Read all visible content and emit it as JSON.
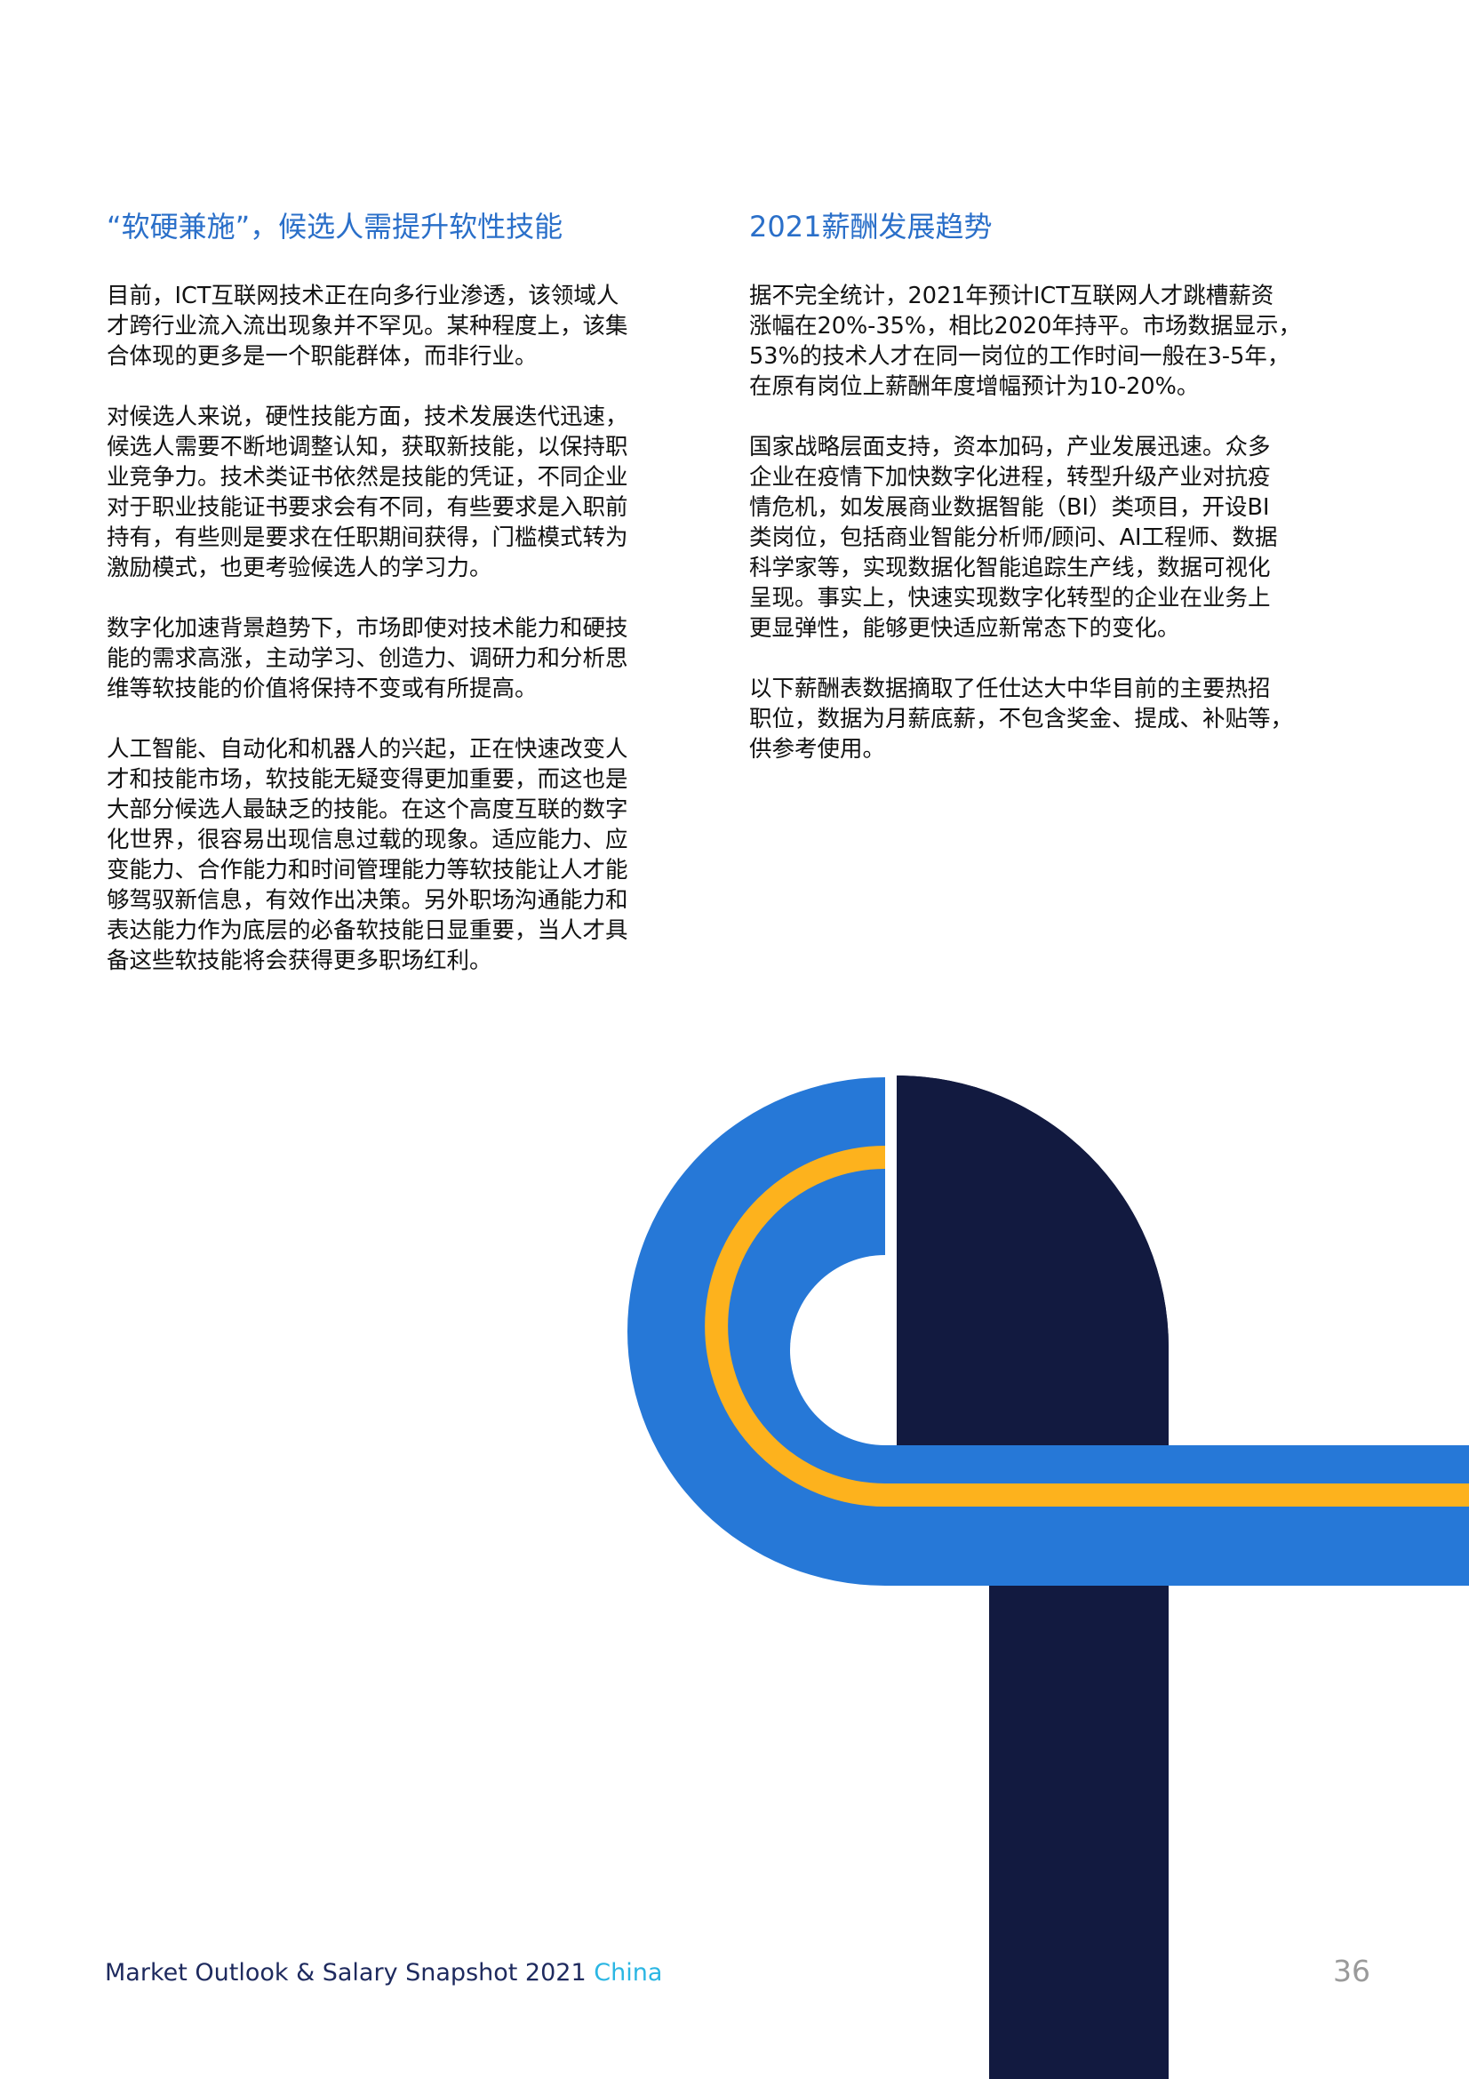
{
  "colors": {
    "heading": "#2a6fc9",
    "navy": "#121a40",
    "blue": "#2678d7",
    "yellow": "#fdb21d",
    "footer_text": "#1e2a5e",
    "footer_accent": "#2bb6e3",
    "page_num": "#9a9a9a"
  },
  "left_column": {
    "heading": "“软硬兼施”，候选人需提升软性技能",
    "paragraphs": [
      {
        "lines": [
          "目前，ICT互联网技术正在向多行业渗透，该领域人",
          "才跨行业流入流出现象并不罕见。某种程度上，该集",
          "合体现的更多是一个职能群体，而非行业。"
        ]
      },
      {
        "lines": [
          "对候选人来说，硬性技能方面，技术发展迭代迅速，",
          "候选人需要不断地调整认知，获取新技能，以保持职",
          "业竞争力。技术类证书依然是技能的凭证，不同企业",
          "对于职业技能证书要求会有不同，有些要求是入职前",
          "持有，有些则是要求在任职期间获得，门槛模式转为",
          "激励模式，也更考验候选人的学习力。"
        ]
      },
      {
        "lines": [
          "数字化加速背景趋势下，市场即使对技术能力和硬技",
          "能的需求高涨，主动学习、创造力、调研力和分析思",
          "维等软技能的价值将保持不变或有所提高。"
        ]
      },
      {
        "lines": [
          "人工智能、自动化和机器人的兴起，正在快速改变人",
          "才和技能市场，软技能无疑变得更加重要，而这也是",
          "大部分候选人最缺乏的技能。在这个高度互联的数字",
          "化世界，很容易出现信息过载的现象。适应能力、应",
          "变能力、合作能力和时间管理能力等软技能让人才能",
          "够驾驭新信息，有效作出决策。另外职场沟通能力和",
          "表达能力作为底层的必备软技能日显重要，当人才具",
          "备这些软技能将会获得更多职场红利。"
        ]
      }
    ]
  },
  "right_column": {
    "heading": "2021薪酬发展趋势",
    "paragraphs": [
      {
        "lines": [
          "据不完全统计，2021年预计ICT互联网人才跳槽薪资",
          "涨幅在20%-35%，相比2020年持平。市场数据显示，",
          "53%的技术人才在同一岗位的工作时间一般在3-5年，",
          "在原有岗位上薪酬年度增幅预计为10-20%。"
        ]
      },
      {
        "lines": [
          "国家战略层面支持，资本加码，产业发展迅速。众多",
          "企业在疫情下加快数字化进程，转型升级产业对抗疫",
          "情危机，如发展商业数据智能（BI）类项目，开设BI",
          "类岗位，包括商业智能分析师/顾问、AI工程师、数据",
          "科学家等，实现数据化智能追踪生产线，数据可视化",
          "呈现。事实上，快速实现数字化转型的企业在业务上",
          "更显弹性，能够更快适应新常态下的变化。"
        ]
      },
      {
        "lines": [
          "以下薪酬表数据摘取了任仕达大中华目前的主要热招",
          "职位，数据为月薪底薪，不包含奖金、提成、补贴等，",
          "供参考使用。"
        ]
      }
    ]
  },
  "footer": {
    "title": "Market Outlook & Salary Snapshot 2021",
    "region": "China",
    "page_number": "36"
  }
}
